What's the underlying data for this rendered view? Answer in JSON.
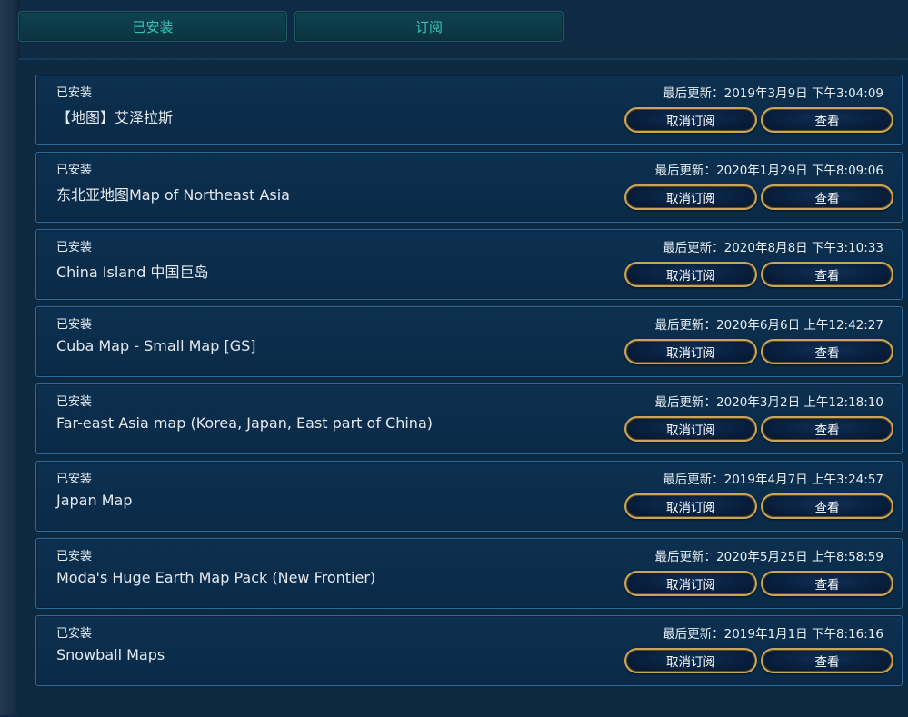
{
  "tabs": [
    {
      "label": "已安装",
      "active": true
    },
    {
      "label": "订阅",
      "active": false
    }
  ],
  "colors": {
    "tab_text": "#38c4b4",
    "button_border": "#c9a55a",
    "card_border": "#2c6a9c",
    "background": "#0d2942"
  },
  "items": [
    {
      "status": "已安装",
      "title": "【地图】艾泽拉斯",
      "updated": "最后更新：2019年3月9日 下午3:04:09",
      "unsubscribe": "取消订阅",
      "view": "查看"
    },
    {
      "status": "已安装",
      "title": "东北亚地图Map of Northeast Asia",
      "updated": "最后更新：2020年1月29日 下午8:09:06",
      "unsubscribe": "取消订阅",
      "view": "查看"
    },
    {
      "status": "已安装",
      "title": "China Island 中国巨岛",
      "updated": "最后更新：2020年8月8日 下午3:10:33",
      "unsubscribe": "取消订阅",
      "view": "查看"
    },
    {
      "status": "已安装",
      "title": "Cuba Map - Small Map [GS]",
      "updated": "最后更新：2020年6月6日 上午12:42:27",
      "unsubscribe": "取消订阅",
      "view": "查看"
    },
    {
      "status": "已安装",
      "title": "Far-east Asia map (Korea, Japan, East part of China)",
      "updated": "最后更新：2020年3月2日 上午12:18:10",
      "unsubscribe": "取消订阅",
      "view": "查看"
    },
    {
      "status": "已安装",
      "title": "Japan Map",
      "updated": "最后更新：2019年4月7日 上午3:24:57",
      "unsubscribe": "取消订阅",
      "view": "查看"
    },
    {
      "status": "已安装",
      "title": "Moda's Huge Earth Map Pack (New Frontier)",
      "updated": "最后更新：2020年5月25日 上午8:58:59",
      "unsubscribe": "取消订阅",
      "view": "查看"
    },
    {
      "status": "已安装",
      "title": "Snowball Maps",
      "updated": "最后更新：2019年1月1日 下午8:16:16",
      "unsubscribe": "取消订阅",
      "view": "查看"
    }
  ]
}
